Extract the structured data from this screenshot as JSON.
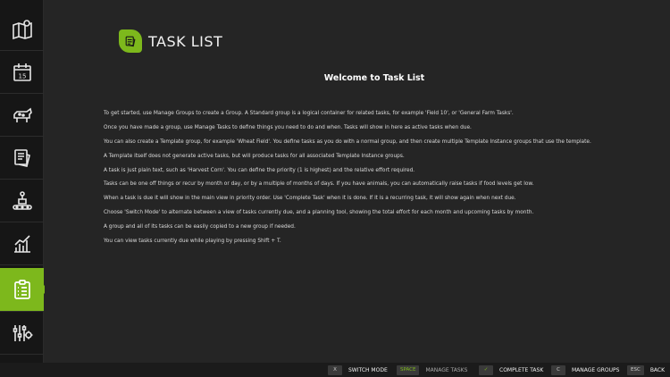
{
  "sidebar": {
    "items": [
      {
        "name": "map",
        "icon": "map-pin-icon"
      },
      {
        "name": "calendar",
        "icon": "calendar-icon",
        "badge": "15"
      },
      {
        "name": "animals",
        "icon": "cow-icon"
      },
      {
        "name": "contracts",
        "icon": "documents-icon"
      },
      {
        "name": "production",
        "icon": "conveyor-icon"
      },
      {
        "name": "statistics",
        "icon": "bar-chart-icon"
      },
      {
        "name": "task-list",
        "icon": "clipboard-list-icon",
        "active": true
      },
      {
        "name": "settings",
        "icon": "sliders-gear-icon"
      }
    ],
    "accent": "#7db81c"
  },
  "header": {
    "title": "TASK LIST"
  },
  "content": {
    "heading": "Welcome to Task List",
    "paragraphs": [
      "To get started, use Manage Groups to create a Group. A Standard group is a logical container for related tasks, for example 'Field 10', or 'General Farm Tasks'.",
      "Once you have made a group, use Manage Tasks to define things you need to do and when. Tasks will show in here as active tasks when due.",
      "You can also create a Template group, for example 'Wheat Field'. You define tasks as you do with a normal group, and then create multiple Template Instance groups that use the template.",
      "A Template itself does not generate active tasks, but will produce tasks for all associated Template Instance groups.",
      "A task is just plain text, such as 'Harvest Corn'. You can define the priority (1 is highest) and the relative effort required.",
      "Tasks can be one off things or recur by month or day, or by a multiple of months of days. If you have animals, you can automatically raise tasks if food levels get low.",
      "When a task is due it will show in the main view in priority order. Use 'Complete Task' when it is done. If it is a recurring task, it will show again when next due.",
      "Choose 'Switch Mode' to alternate between a view of tasks currently due, and a planning tool, showing the total effort for each month and upcoming tasks by month.",
      "A group and all of its tasks can be easily copied to a new group if needed.",
      "You can view tasks currently due while playing by pressing Shift + T."
    ]
  },
  "footer": {
    "hints": [
      {
        "key": "X",
        "label": "SWITCH MODE"
      },
      {
        "key": "SPACE",
        "label": "MANAGE TASKS"
      },
      {
        "key": "✓",
        "label": "COMPLETE TASK"
      },
      {
        "key": "C",
        "label": "MANAGE GROUPS"
      },
      {
        "key": "ESC",
        "label": "BACK"
      }
    ]
  }
}
